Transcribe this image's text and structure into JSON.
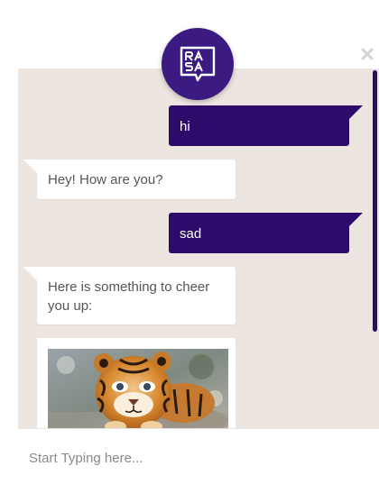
{
  "widget": {
    "brand_colors": {
      "primary": "#2d0b6b",
      "background": "#ede5df"
    },
    "logo_icon": "rasa-logo-icon",
    "close_icon": "close-icon"
  },
  "messages": [
    {
      "sender": "user",
      "text": "hi"
    },
    {
      "sender": "bot",
      "text": "Hey! How are you?"
    },
    {
      "sender": "user",
      "text": "sad"
    },
    {
      "sender": "bot",
      "text": "Here is something to cheer you up:"
    },
    {
      "sender": "bot",
      "type": "image",
      "icon": "tiger-cub-image"
    }
  ],
  "input": {
    "placeholder": "Start Typing here..."
  }
}
